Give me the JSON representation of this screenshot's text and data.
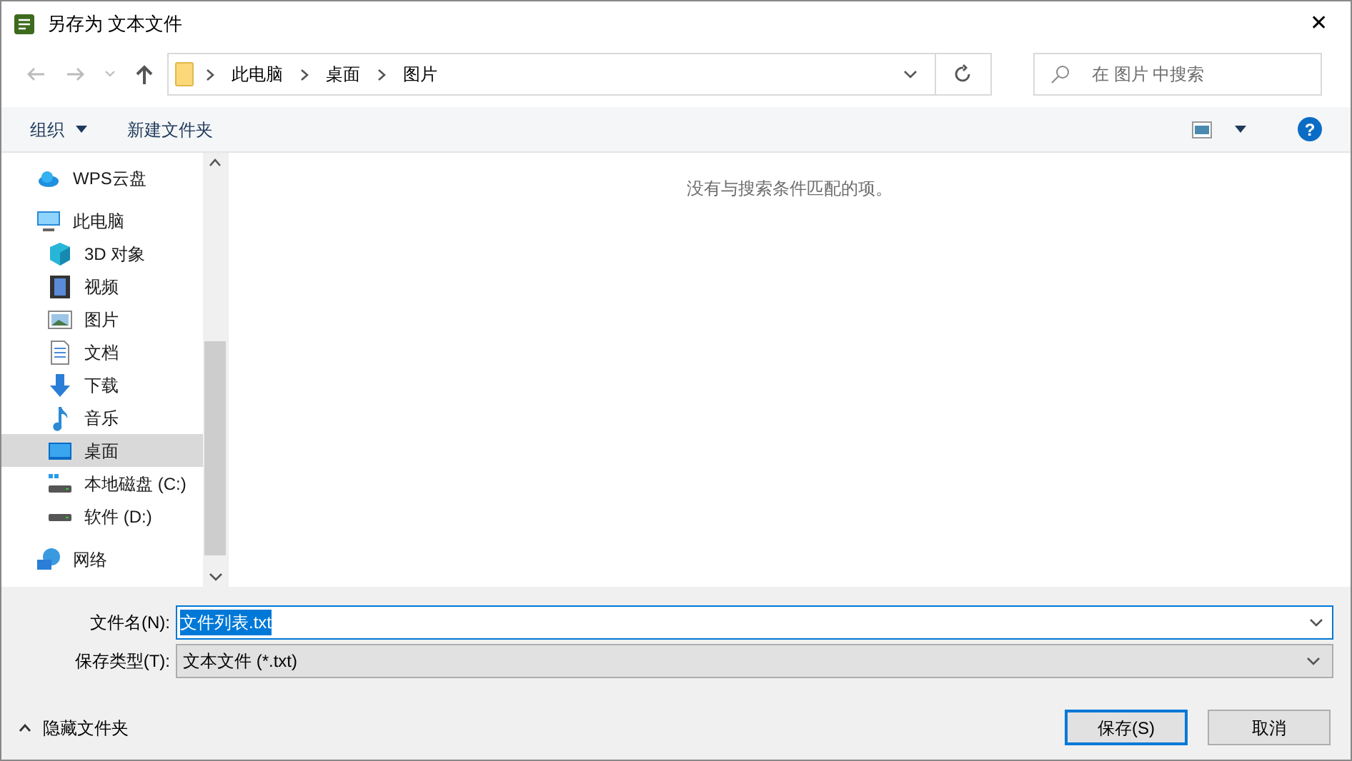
{
  "window": {
    "title": "另存为 文本文件",
    "close": "✕"
  },
  "address": {
    "crumbs": [
      "此电脑",
      "桌面",
      "图片"
    ],
    "search_placeholder": "在 图片 中搜索"
  },
  "toolbar": {
    "organize": "组织",
    "new_folder": "新建文件夹",
    "help": "?"
  },
  "sidebar": {
    "items": [
      {
        "label": "WPS云盘",
        "kind": "cloud",
        "selected": false
      },
      {
        "label": "此电脑",
        "kind": "pc",
        "selected": false,
        "children": [
          {
            "label": "3D 对象",
            "kind": "cube",
            "selected": false
          },
          {
            "label": "视频",
            "kind": "film",
            "selected": false
          },
          {
            "label": "图片",
            "kind": "image",
            "selected": false
          },
          {
            "label": "文档",
            "kind": "doc",
            "selected": false
          },
          {
            "label": "下载",
            "kind": "download",
            "selected": false
          },
          {
            "label": "音乐",
            "kind": "music",
            "selected": false
          },
          {
            "label": "桌面",
            "kind": "desktop",
            "selected": true
          },
          {
            "label": "本地磁盘 (C:)",
            "kind": "sysdrive",
            "selected": false
          },
          {
            "label": "软件 (D:)",
            "kind": "drive",
            "selected": false
          }
        ]
      },
      {
        "label": "网络",
        "kind": "network",
        "selected": false
      }
    ]
  },
  "content": {
    "empty_message": "没有与搜索条件匹配的项。"
  },
  "form": {
    "filename_label": "文件名(N):",
    "filename": "文件列表.txt",
    "filename_selected": true,
    "filetype_label": "保存类型(T):",
    "filetype": "文本文件 (*.txt)"
  },
  "footer": {
    "hide_folders": "隐藏文件夹",
    "save": "保存(S)",
    "cancel": "取消"
  }
}
